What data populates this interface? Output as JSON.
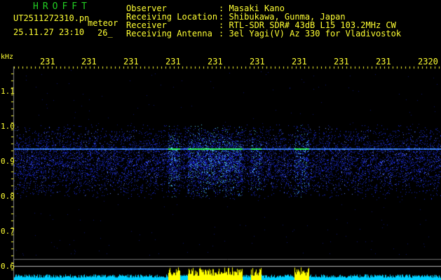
{
  "header": {
    "logo": "HROFFT",
    "filename": "UT2511272310.pn",
    "mode": "meteor",
    "datetime": "25.11.27 23:10",
    "counter": "26_"
  },
  "info": {
    "observer_label": "Observer",
    "observer_value": ": Masaki Kano",
    "location_label": "Receiving Location",
    "location_value": ": Shibukawa, Gunma, Japan",
    "receiver_label": "Receiver",
    "receiver_value": ": RTL-SDR SDR# 43dB L15 103.2MHz CW",
    "antenna_label": "Receiving Antenna",
    "antenna_value": ": 3el Yagi(V) Az 330 for Vladivostok"
  },
  "axes": {
    "y_unit": "kHz",
    "x_ticks": [
      "231",
      "231",
      "231",
      "231",
      "231",
      "231",
      "231",
      "231",
      "231",
      "2320"
    ],
    "y_ticks": [
      "1.1",
      "1.0",
      "0.9",
      "0.8",
      "0.7",
      "0.6"
    ]
  },
  "colors": {
    "text": "#ffff33",
    "logo": "#22cc22",
    "noise": "#1a28c8",
    "strong": "#5ad9ff",
    "cw_line": "#33ff66",
    "level_base": "#00d0ff",
    "level_peak": "#ffff00"
  }
}
